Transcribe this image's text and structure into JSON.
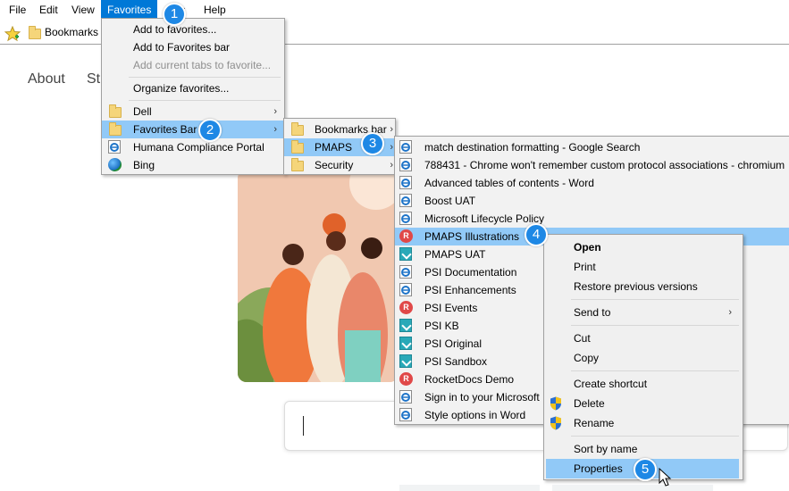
{
  "menubar": {
    "items": [
      "File",
      "Edit",
      "View",
      "Favorites",
      "Tools",
      "Help"
    ],
    "tools_visible": "ls"
  },
  "favorites_bar": {
    "bookmarks_label": "Bookmarks"
  },
  "page": {
    "nav_about": "About",
    "nav_partial": "St"
  },
  "favorites_menu": {
    "add_to_favorites": "Add to favorites...",
    "add_to_favorites_bar": "Add to Favorites bar",
    "add_current_tabs": "Add current tabs to favorite...",
    "organize": "Organize favorites...",
    "dell": "Dell",
    "favorites_bar": "Favorites Bar",
    "humana": "Humana Compliance Portal",
    "bing": "Bing"
  },
  "favbar_submenu": {
    "bookmarks_bar": "Bookmarks bar",
    "pmaps": "PMAPS",
    "security": "Security"
  },
  "pmaps_submenu": {
    "items": [
      {
        "label": "match destination formatting  - Google Search",
        "icon": "ie"
      },
      {
        "label": "788431 - Chrome won't remember custom protocol associations - chromium",
        "icon": "ie"
      },
      {
        "label": "Advanced tables of contents - Word",
        "icon": "ie"
      },
      {
        "label": "Boost UAT",
        "icon": "ie"
      },
      {
        "label": "Microsoft Lifecycle Policy",
        "icon": "ie"
      },
      {
        "label": "PMAPS Illustrations",
        "icon": "rocketdocs"
      },
      {
        "label": "PMAPS UAT",
        "icon": "teal"
      },
      {
        "label": "PSI Documentation",
        "icon": "ie"
      },
      {
        "label": "PSI Enhancements",
        "icon": "ie"
      },
      {
        "label": "PSI Events",
        "icon": "rocketdocs"
      },
      {
        "label": "PSI KB",
        "icon": "teal"
      },
      {
        "label": "PSI Original",
        "icon": "teal"
      },
      {
        "label": "PSI Sandbox",
        "icon": "teal"
      },
      {
        "label": "RocketDocs Demo",
        "icon": "rocketdocs"
      },
      {
        "label": "Sign in to your Microsoft",
        "icon": "ie"
      },
      {
        "label": "Style options in Word",
        "icon": "ie"
      }
    ]
  },
  "context_menu": {
    "open": "Open",
    "print": "Print",
    "restore": "Restore previous versions",
    "send_to": "Send to",
    "cut": "Cut",
    "copy": "Copy",
    "create_shortcut": "Create shortcut",
    "delete": "Delete",
    "rename": "Rename",
    "sort_by_name": "Sort by name",
    "properties": "Properties"
  },
  "callouts": [
    "1",
    "2",
    "3",
    "4",
    "5"
  ],
  "colors": {
    "menu_highlight": "#91c9f7",
    "menubar_active": "#0078d7",
    "callout": "#1e88e5"
  }
}
